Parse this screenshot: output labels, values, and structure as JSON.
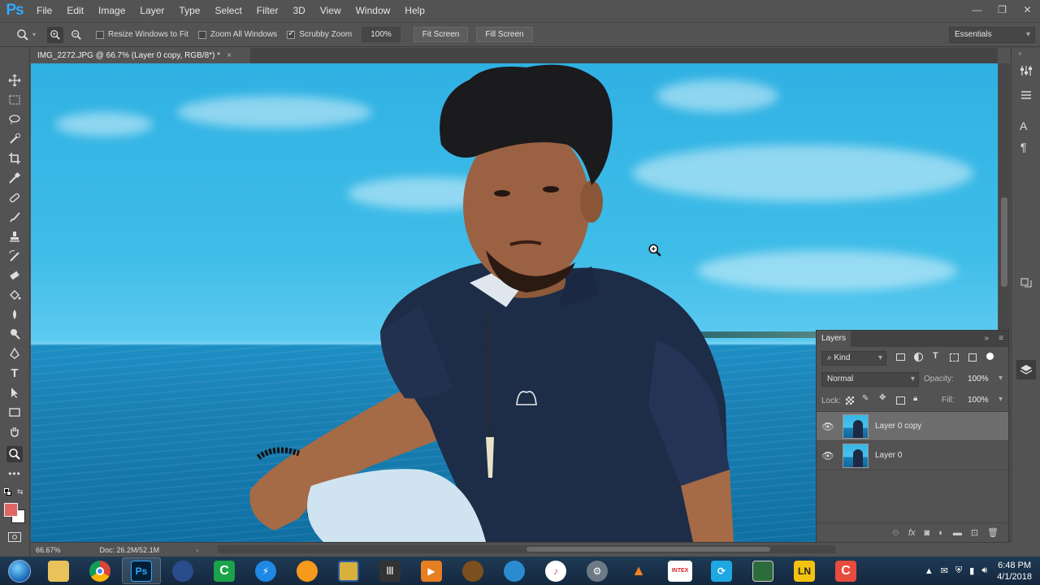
{
  "app": {
    "logo": "Ps",
    "menu": [
      "File",
      "Edit",
      "Image",
      "Layer",
      "Type",
      "Select",
      "Filter",
      "3D",
      "View",
      "Window",
      "Help"
    ],
    "window_controls": [
      "—",
      "❐",
      "✕"
    ]
  },
  "options_bar": {
    "resize_windows_label": "Resize Windows to Fit",
    "resize_windows_checked": false,
    "zoom_all_label": "Zoom All Windows",
    "zoom_all_checked": false,
    "scrubby_zoom_label": "Scrubby Zoom",
    "scrubby_zoom_checked": true,
    "zoom_value": "100%",
    "fit_screen_label": "Fit Screen",
    "fill_screen_label": "Fill Screen",
    "workspace": "Essentials"
  },
  "document": {
    "tab_title": "IMG_2272.JPG @ 66.7% (Layer 0 copy, RGB/8*) *",
    "close": "×"
  },
  "status": {
    "zoom": "66.67%",
    "doc_info": "Doc: 26.2M/52.1M"
  },
  "layers_panel": {
    "title": "Layers",
    "filter_kind": "Kind",
    "blend_mode": "Normal",
    "opacity_label": "Opacity:",
    "opacity_value": "100%",
    "lock_label": "Lock:",
    "fill_label": "Fill:",
    "fill_value": "100%",
    "layers": [
      {
        "name": "Layer 0 copy",
        "selected": true
      },
      {
        "name": "Layer 0",
        "selected": false
      }
    ]
  },
  "taskbar": {
    "time": "6:48 PM",
    "date": "4/1/2018",
    "apps": [
      "file-explorer",
      "chrome",
      "photoshop",
      "media-player",
      "camtasia",
      "messenger",
      "fl-studio",
      "file-manager",
      "audio-editor",
      "slides",
      "fruit-app",
      "web-browser",
      "itunes",
      "settings-app",
      "vlc",
      "intex-app",
      "sync-app",
      "terminal",
      "ln-app",
      "screen-recorder"
    ],
    "intex_label": "INTEX",
    "ln_label": "LN"
  },
  "colors": {
    "ui_bg": "#535353",
    "foreground_swatch": "#e06666",
    "background_swatch": "#ffffff",
    "ps_blue": "#31a8ff"
  }
}
